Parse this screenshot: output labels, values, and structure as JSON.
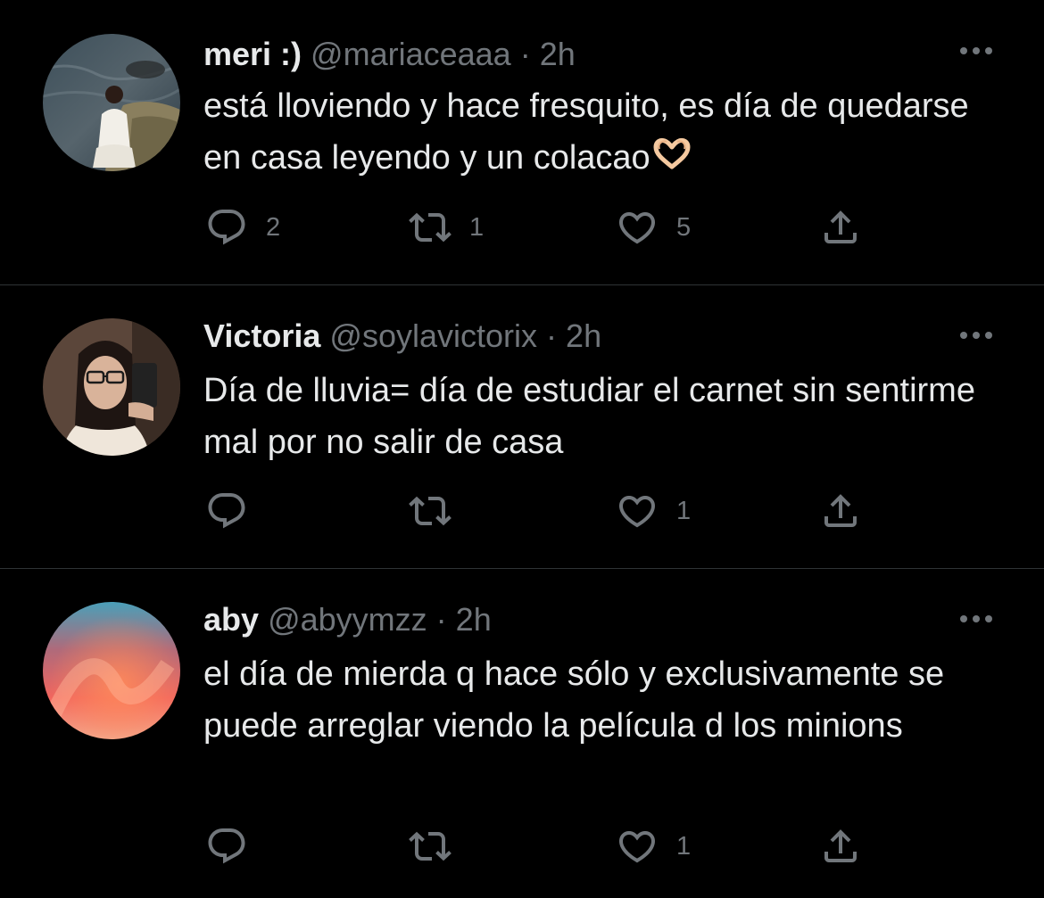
{
  "colors": {
    "background": "#000000",
    "text_primary": "#e7e9ea",
    "text_secondary": "#71767b",
    "divider": "#2f3336"
  },
  "tweets": [
    {
      "name": "meri :)",
      "handle": "@mariaceaaa",
      "separator": "·",
      "time": "2h",
      "text": "está lloviendo y hace fresquito, es día de quedarse en casa leyendo y un colacao",
      "emoji": "heart-hands",
      "replies": "2",
      "retweets": "1",
      "likes": "5"
    },
    {
      "name": "Victoria",
      "handle": "@soylavictorix",
      "separator": "·",
      "time": "2h",
      "text": "Día de lluvia= día de estudiar el carnet sin sentirme mal por no salir de casa",
      "replies": "",
      "retweets": "",
      "likes": "1"
    },
    {
      "name": "aby",
      "handle": "@abyymzz",
      "separator": "·",
      "time": "2h",
      "text": "el día de mierda q hace sólo y exclusivamente se puede arreglar viendo la película d los minions",
      "replies": "",
      "retweets": "",
      "likes": "1"
    }
  ],
  "icons": {
    "reply": "reply-icon",
    "retweet": "retweet-icon",
    "like": "heart-icon",
    "share": "share-icon",
    "more": "more-icon"
  }
}
